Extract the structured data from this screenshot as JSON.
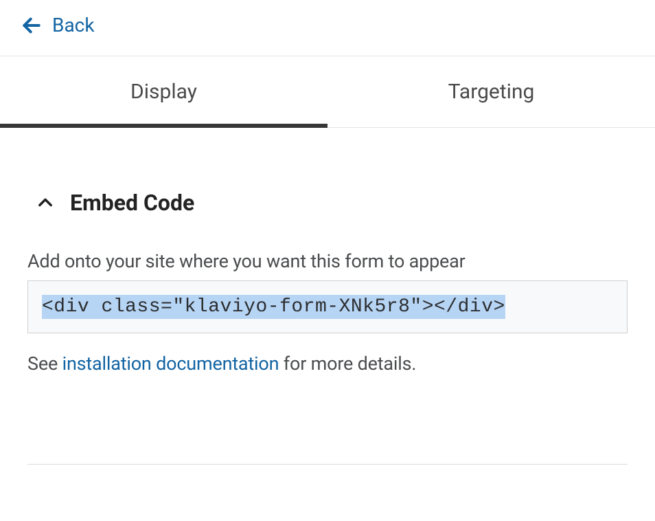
{
  "header": {
    "back_label": "Back"
  },
  "tabs": {
    "display": "Display",
    "targeting": "Targeting"
  },
  "section": {
    "title": "Embed Code",
    "description": "Add onto your site where you want this form to appear",
    "code_snippet": "<div class=\"klaviyo-form-XNk5r8\"></div>",
    "footer_prefix": "See ",
    "footer_link": "installation documentation",
    "footer_suffix": " for more details."
  }
}
